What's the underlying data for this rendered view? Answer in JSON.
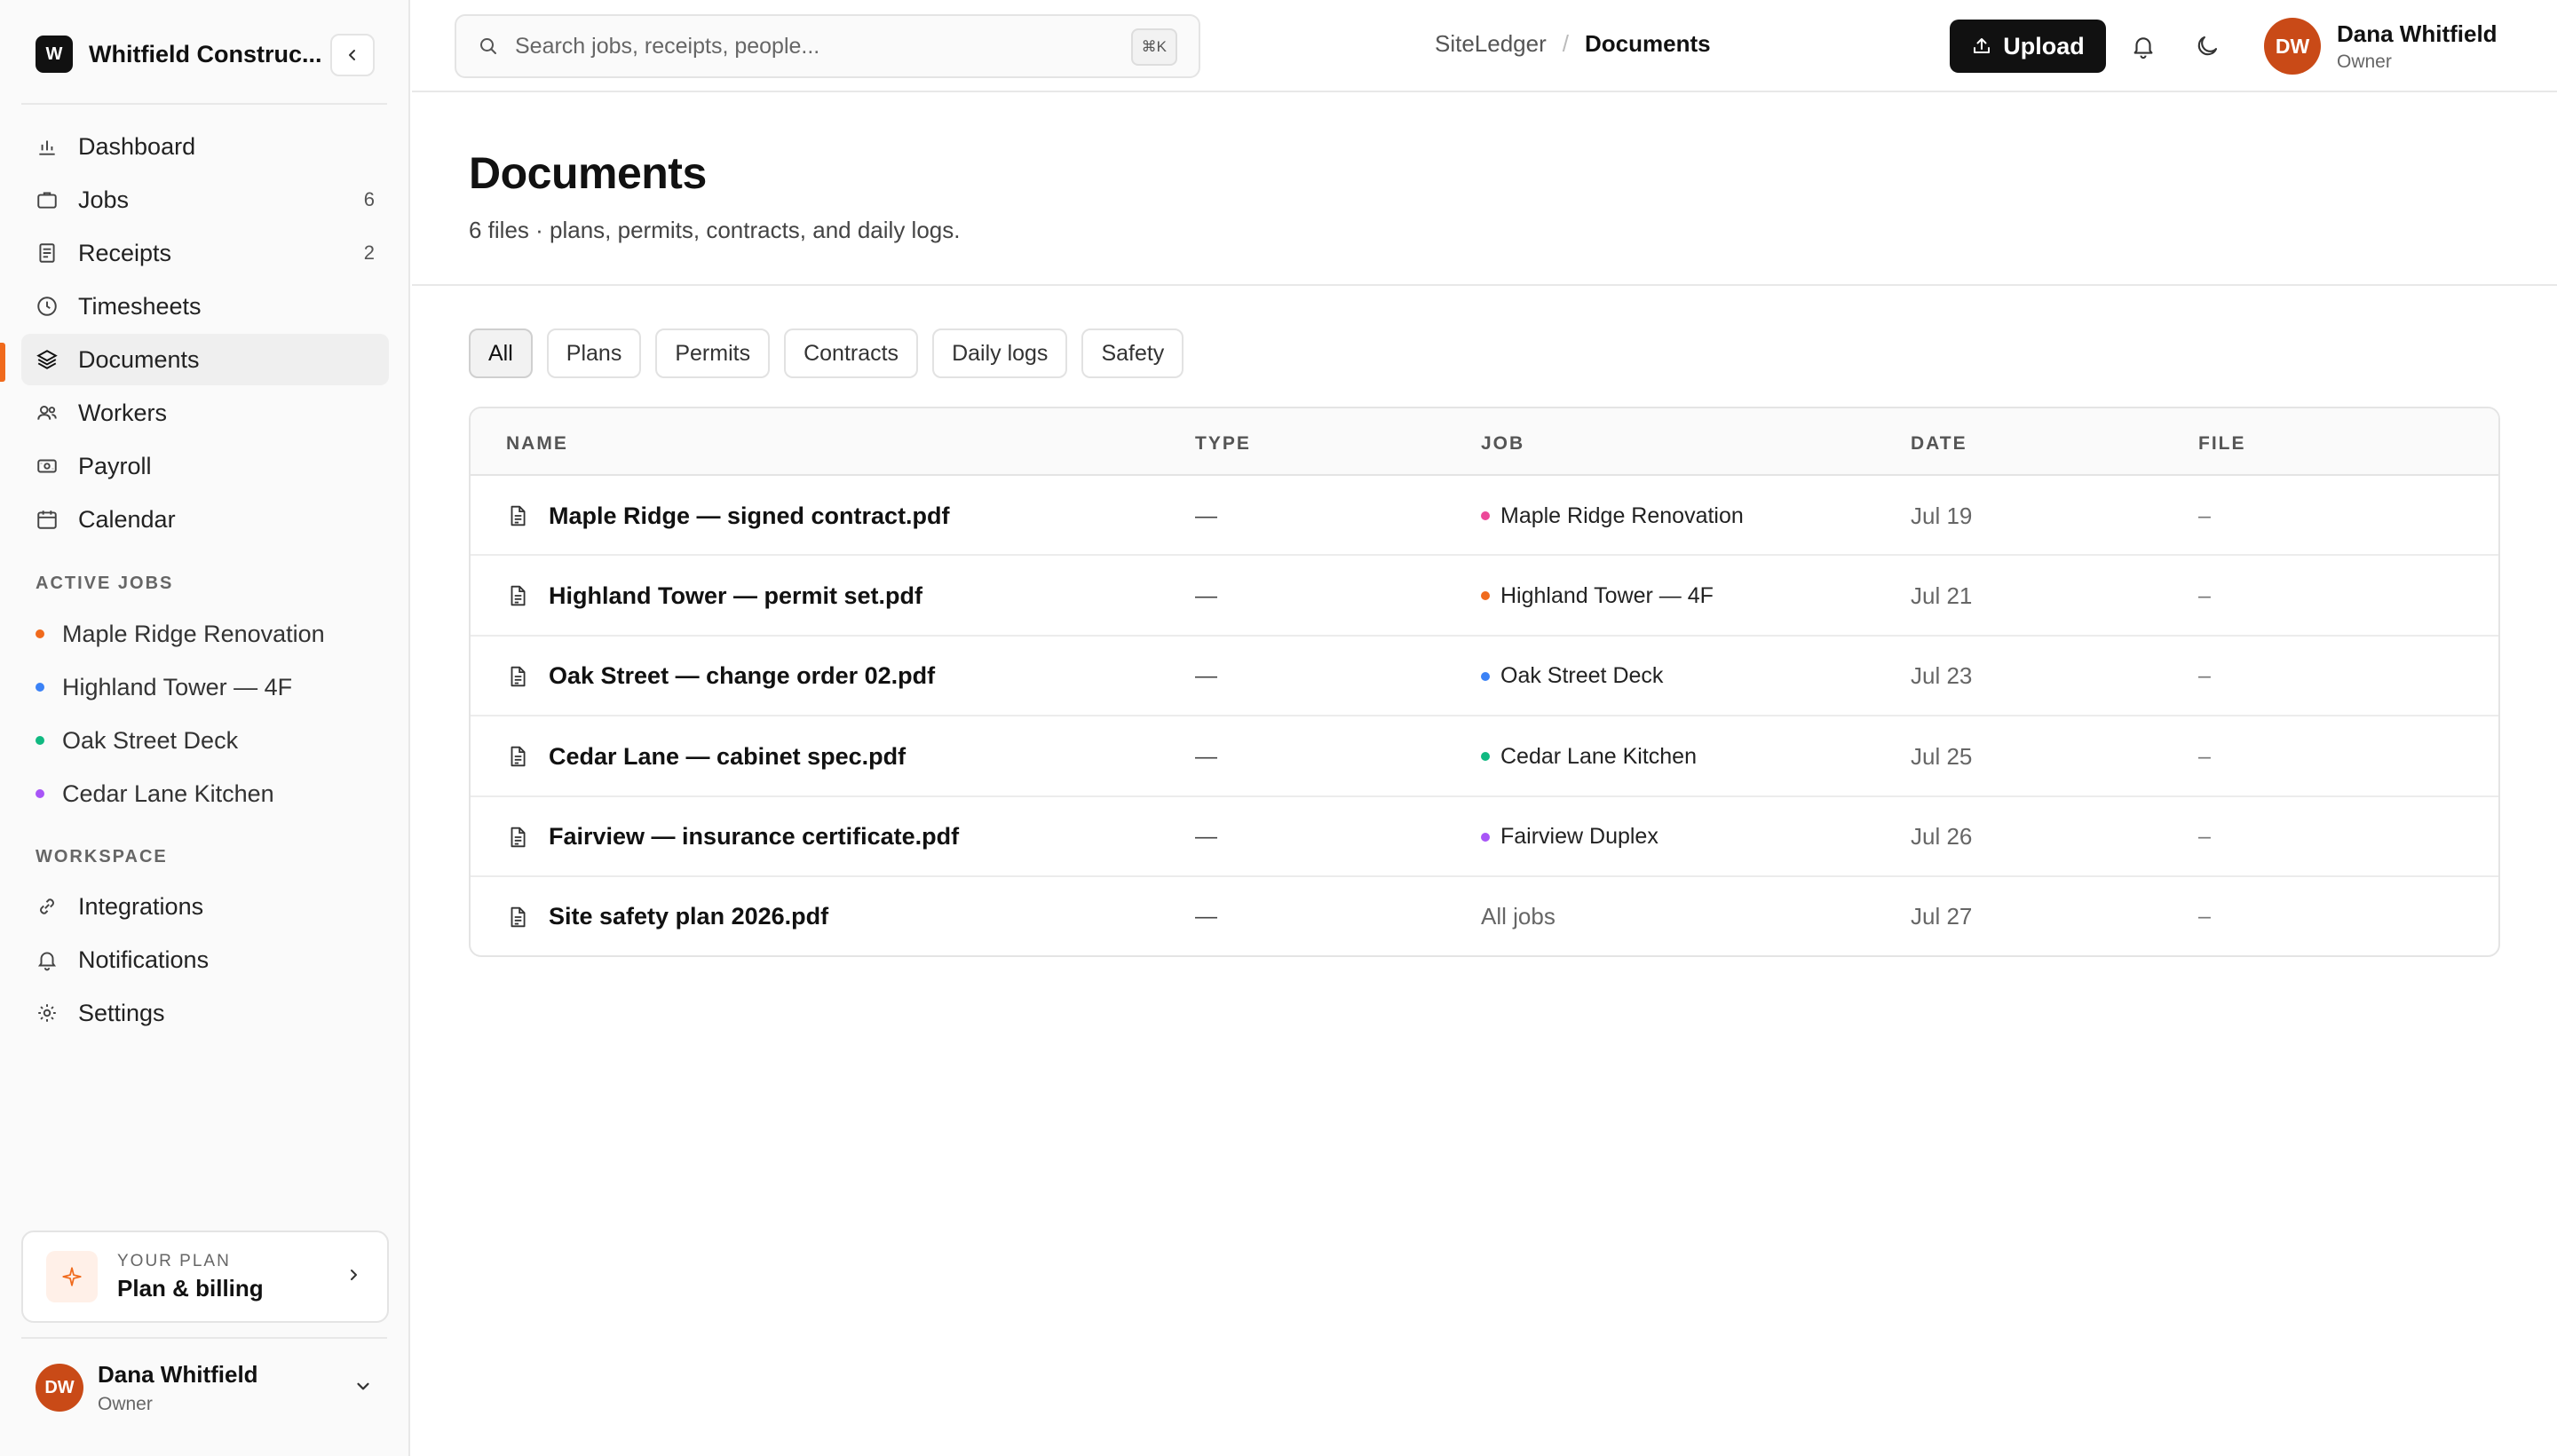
{
  "sidebar": {
    "brand_logo": "W",
    "brand_name": "Whitfield Construc...",
    "nav": [
      {
        "label": "Dashboard",
        "icon": "bar-chart-icon",
        "count": ""
      },
      {
        "label": "Jobs",
        "icon": "briefcase-icon",
        "count": "6"
      },
      {
        "label": "Receipts",
        "icon": "receipt-icon",
        "count": "2"
      },
      {
        "label": "Timesheets",
        "icon": "clock-icon",
        "count": ""
      },
      {
        "label": "Documents",
        "icon": "layers-icon",
        "count": "",
        "active": true
      },
      {
        "label": "Workers",
        "icon": "users-icon",
        "count": ""
      },
      {
        "label": "Payroll",
        "icon": "banknote-icon",
        "count": ""
      },
      {
        "label": "Calendar",
        "icon": "calendar-icon",
        "count": ""
      }
    ],
    "active_jobs_label": "ACTIVE JOBS",
    "active_jobs": [
      {
        "label": "Maple Ridge Renovation",
        "color": "#f06a1c"
      },
      {
        "label": "Highland Tower — 4F",
        "color": "#3b82f6"
      },
      {
        "label": "Oak Street Deck",
        "color": "#10b981"
      },
      {
        "label": "Cedar Lane Kitchen",
        "color": "#a855f7"
      }
    ],
    "workspace_label": "WORKSPACE",
    "workspace": [
      {
        "label": "Integrations",
        "icon": "link-icon"
      },
      {
        "label": "Notifications",
        "icon": "bell-icon"
      },
      {
        "label": "Settings",
        "icon": "gear-icon"
      }
    ],
    "plan": {
      "kicker": "YOUR PLAN",
      "title": "Plan & billing"
    },
    "user": {
      "initials": "DW",
      "name": "Dana Whitfield",
      "role": "Owner"
    }
  },
  "header": {
    "search_placeholder": "Search jobs, receipts, people...",
    "search_shortcut": "⌘K",
    "breadcrumb_root": "SiteLedger",
    "breadcrumb_sep": "/",
    "breadcrumb_current": "Documents",
    "upload_label": "Upload",
    "user": {
      "initials": "DW",
      "name": "Dana Whitfield",
      "role": "Owner"
    }
  },
  "main": {
    "title": "Documents",
    "subtitle": "6 files · plans, permits, contracts, and daily logs.",
    "filters": [
      "All",
      "Plans",
      "Permits",
      "Contracts",
      "Daily logs",
      "Safety"
    ],
    "active_filter": "All",
    "columns": {
      "name": "NAME",
      "type": "TYPE",
      "job": "JOB",
      "date": "DATE",
      "file": "FILE"
    },
    "rows": [
      {
        "name": "Maple Ridge — signed contract.pdf",
        "type": "—",
        "job": "Maple Ridge Renovation",
        "job_color": "#ec4899",
        "date": "Jul 19",
        "file": "–"
      },
      {
        "name": "Highland Tower — permit set.pdf",
        "type": "—",
        "job": "Highland Tower — 4F",
        "job_color": "#f06a1c",
        "date": "Jul 21",
        "file": "–"
      },
      {
        "name": "Oak Street — change order 02.pdf",
        "type": "—",
        "job": "Oak Street Deck",
        "job_color": "#3b82f6",
        "date": "Jul 23",
        "file": "–"
      },
      {
        "name": "Cedar Lane — cabinet spec.pdf",
        "type": "—",
        "job": "Cedar Lane Kitchen",
        "job_color": "#10b981",
        "date": "Jul 25",
        "file": "–"
      },
      {
        "name": "Fairview — insurance certificate.pdf",
        "type": "—",
        "job": "Fairview Duplex",
        "job_color": "#a855f7",
        "date": "Jul 26",
        "file": "–"
      },
      {
        "name": "Site safety plan 2026.pdf",
        "type": "—",
        "job": "All jobs",
        "job_color": "",
        "date": "Jul 27",
        "file": "–"
      }
    ]
  }
}
